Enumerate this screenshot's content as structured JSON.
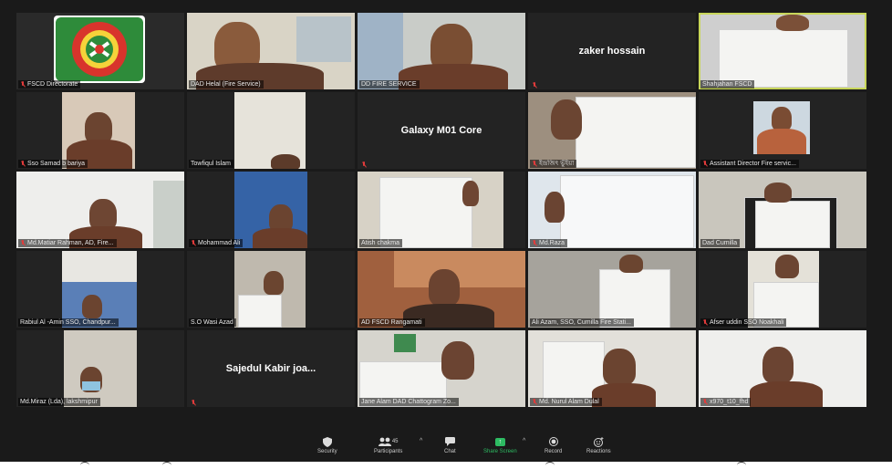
{
  "participants": [
    {
      "name": "FSCD Directorate",
      "muted": true
    },
    {
      "name": "DAD Helal (Fire Service)",
      "muted": false
    },
    {
      "name": "DD FIRE SERVICE",
      "muted": false
    },
    {
      "name": "",
      "muted": true,
      "center_name": "zaker hossain"
    },
    {
      "name": "Shahjahan FSCD",
      "muted": false,
      "active": true
    },
    {
      "name": "Sso Samad b bariya",
      "muted": true
    },
    {
      "name": "Towfiqul Islam",
      "muted": false
    },
    {
      "name": "",
      "muted": true,
      "center_name": "Galaxy M01 Core"
    },
    {
      "name": "ইন্দ্রজিৎ ভুঁইয়া",
      "muted": true
    },
    {
      "name": "Assistant Director Fire servic...",
      "muted": true
    },
    {
      "name": "Md.Matiar Rahman, AD, Fire...",
      "muted": true
    },
    {
      "name": "Mohammad Ali",
      "muted": true
    },
    {
      "name": "Atish chakma",
      "muted": false
    },
    {
      "name": "Md.Raza",
      "muted": true
    },
    {
      "name": "Dad Cumilla",
      "muted": false
    },
    {
      "name": "Rabiul Al -Amin SSO, Chandpur...",
      "muted": false
    },
    {
      "name": "S.O Wasi Azad",
      "muted": false
    },
    {
      "name": "AD FSCD Rangamati",
      "muted": false
    },
    {
      "name": "Ali Azam, SSO, Cumilla Fire Stati...",
      "muted": false
    },
    {
      "name": "Afser uddin SSO Noakhali",
      "muted": true
    },
    {
      "name": "Md.Miraz (Lda), lakshmipur",
      "muted": false
    },
    {
      "name": "",
      "muted": true,
      "center_name": "Sajedul Kabir joa..."
    },
    {
      "name": "Jane Alam DAD Chattogram Zo...",
      "muted": false
    },
    {
      "name": "Md. Nurul Alam Dulal",
      "muted": true
    },
    {
      "name": "x970_t10_fhd",
      "muted": true
    }
  ],
  "toolbar": {
    "security": "Security",
    "participants": "Participants",
    "participants_count": "45",
    "chat": "Chat",
    "share_screen": "Share Screen",
    "record": "Record",
    "reactions": "Reactions"
  },
  "colors": {
    "active_border": "#c8d65a",
    "share_green": "#2dbb62",
    "muted_red": "#e23b3b"
  }
}
